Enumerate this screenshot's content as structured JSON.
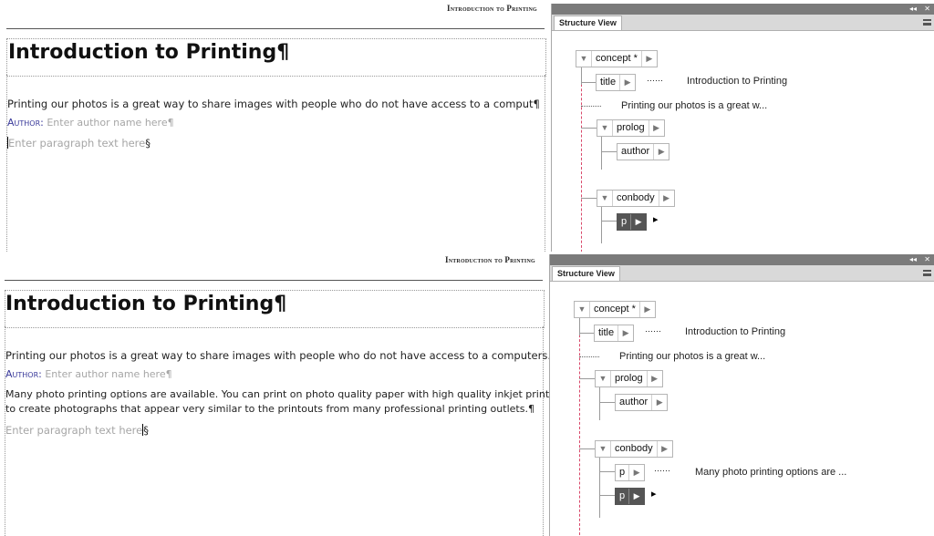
{
  "top": {
    "running_header": "Introduction to Printing",
    "title": "Introduction to Printing¶",
    "shortdesc": "Printing our photos is a great way to share images with people who do not have access to a comput¶",
    "author_label": "Author:",
    "author_placeholder": "Enter author name here¶",
    "paragraph_placeholder": "Enter paragraph text here",
    "section_mark": "§"
  },
  "bottom": {
    "running_header": "Introduction to Printing",
    "title": "Introduction to Printing¶",
    "shortdesc": "Printing our photos is a great way to share images with people who do not have access to a computers.¶",
    "author_label": "Author:",
    "author_placeholder": "Enter author name here¶",
    "paragraph_line1": "Many photo printing options are available. You can print on photo quality paper with high quality inkjet printers",
    "paragraph_line2": "to create photographs that appear very similar to the printouts from many professional printing outlets.¶",
    "paragraph_placeholder": "Enter paragraph text here",
    "section_mark": "§"
  },
  "structure_view_top": {
    "tab_title": "Structure View",
    "controls": {
      "collapse": "◂◂",
      "close": "✕"
    },
    "nodes": {
      "concept": "concept *",
      "title": "title",
      "title_preview": "Introduction to Printing",
      "shortdesc_preview": "Printing our photos is a great w...",
      "prolog": "prolog",
      "author": "author",
      "conbody": "conbody",
      "p": "p"
    }
  },
  "structure_view_bottom": {
    "tab_title": "Structure View",
    "controls": {
      "collapse": "◂◂",
      "close": "✕"
    },
    "nodes": {
      "concept": "concept *",
      "title": "title",
      "title_preview": "Introduction to Printing",
      "shortdesc_preview": "Printing our photos is a great w...",
      "prolog": "prolog",
      "author": "author",
      "conbody": "conbody",
      "p1": "p",
      "p1_preview": "Many photo printing options are ...",
      "p2": "p"
    }
  },
  "glyphs": {
    "twisty": "▼",
    "arrow": "▶",
    "caret": "▸",
    "dots": "······"
  },
  "colors": {
    "panel_titlebar": "#7b7b7b",
    "tab_bar": "#d9d9d9",
    "author_label": "#3a3a9a",
    "placeholder": "#a6a6a6",
    "selected_node": "#555555",
    "insertion_line": "#d9486a"
  }
}
